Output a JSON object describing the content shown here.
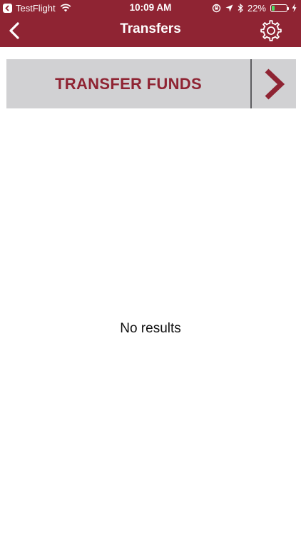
{
  "status_bar": {
    "back_app_label": "TestFlight",
    "time": "10:09 AM",
    "battery_percent": "22%",
    "battery_level": 0.22
  },
  "nav": {
    "title": "Transfers",
    "back_icon": "chevron-left-icon",
    "settings_icon": "gear-icon"
  },
  "transfer_button": {
    "label": "TRANSFER FUNDS",
    "chevron_icon": "chevron-right-icon"
  },
  "empty_state": {
    "message": "No results"
  },
  "colors": {
    "brand": "#8f2433",
    "button_bg": "#d1d1d3",
    "battery": "#4cd964"
  }
}
